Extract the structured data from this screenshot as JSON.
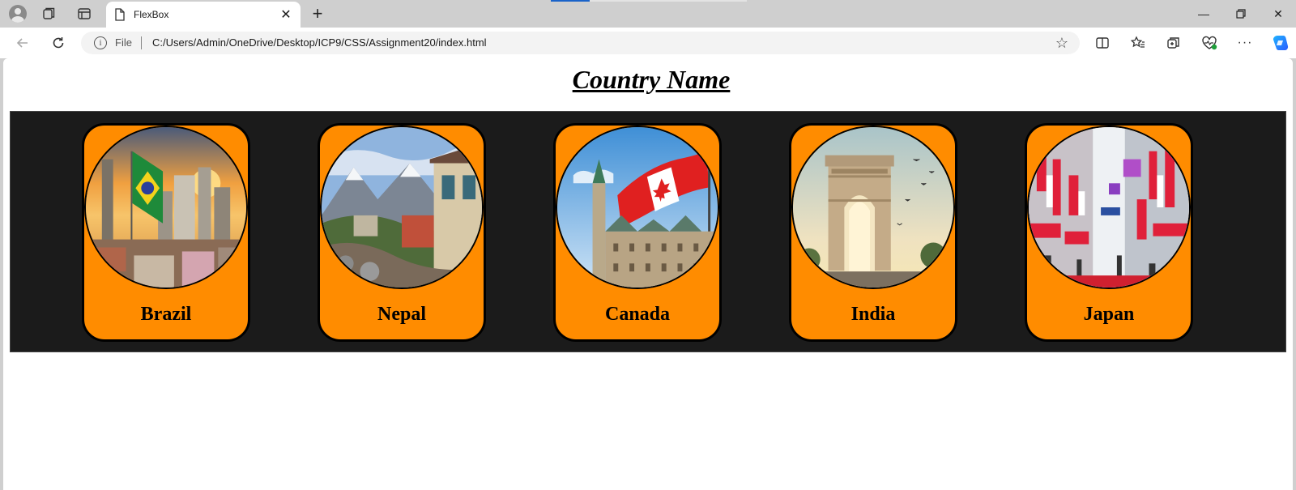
{
  "browser": {
    "tab_title": "FlexBox",
    "file_label": "File",
    "url": "C:/Users/Admin/OneDrive/Desktop/ICP9/CSS/Assignment20/index.html"
  },
  "page": {
    "title": "Country Name",
    "countries": [
      {
        "name": "Brazil",
        "image": "brazil-city-flag-photo"
      },
      {
        "name": "Nepal",
        "image": "nepal-mountain-village-photo"
      },
      {
        "name": "Canada",
        "image": "canada-parliament-flag-photo"
      },
      {
        "name": "India",
        "image": "india-gate-photo"
      },
      {
        "name": "Japan",
        "image": "japan-street-signs-photo"
      }
    ]
  },
  "colors": {
    "card": "#ff8c00",
    "strip": "#1b1b1b",
    "title": "#000000"
  }
}
